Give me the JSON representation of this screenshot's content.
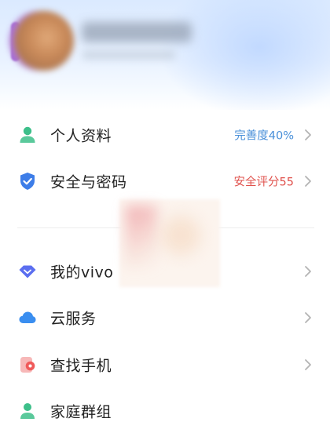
{
  "profile": {
    "avatar_icon": "user-avatar",
    "name": "",
    "subtitle": ""
  },
  "menu": {
    "items": [
      {
        "label": "个人资料",
        "value": "完善度40%",
        "value_color": "#4a90d9",
        "icon": "person-icon",
        "icon_color": "#3dbf8a"
      },
      {
        "label": "安全与密码",
        "value": "安全评分55",
        "value_color": "#e0524d",
        "icon": "shield-check-icon",
        "icon_color": "#3d7de8"
      },
      {
        "label": "我的vivo",
        "value": "",
        "icon": "diamond-icon",
        "icon_color": "#5b6ef0"
      },
      {
        "label": "云服务",
        "value": "",
        "icon": "cloud-icon",
        "icon_color": "#3a8ef0"
      },
      {
        "label": "查找手机",
        "value": "",
        "icon": "find-phone-icon",
        "icon_color": "#f05a5a"
      },
      {
        "label": "家庭群组",
        "value": "",
        "icon": "family-icon",
        "icon_color": "#3dbf8a"
      }
    ]
  },
  "colors": {
    "chevron": "#b4b4b4",
    "label": "#222222",
    "divider": "#ececec"
  }
}
